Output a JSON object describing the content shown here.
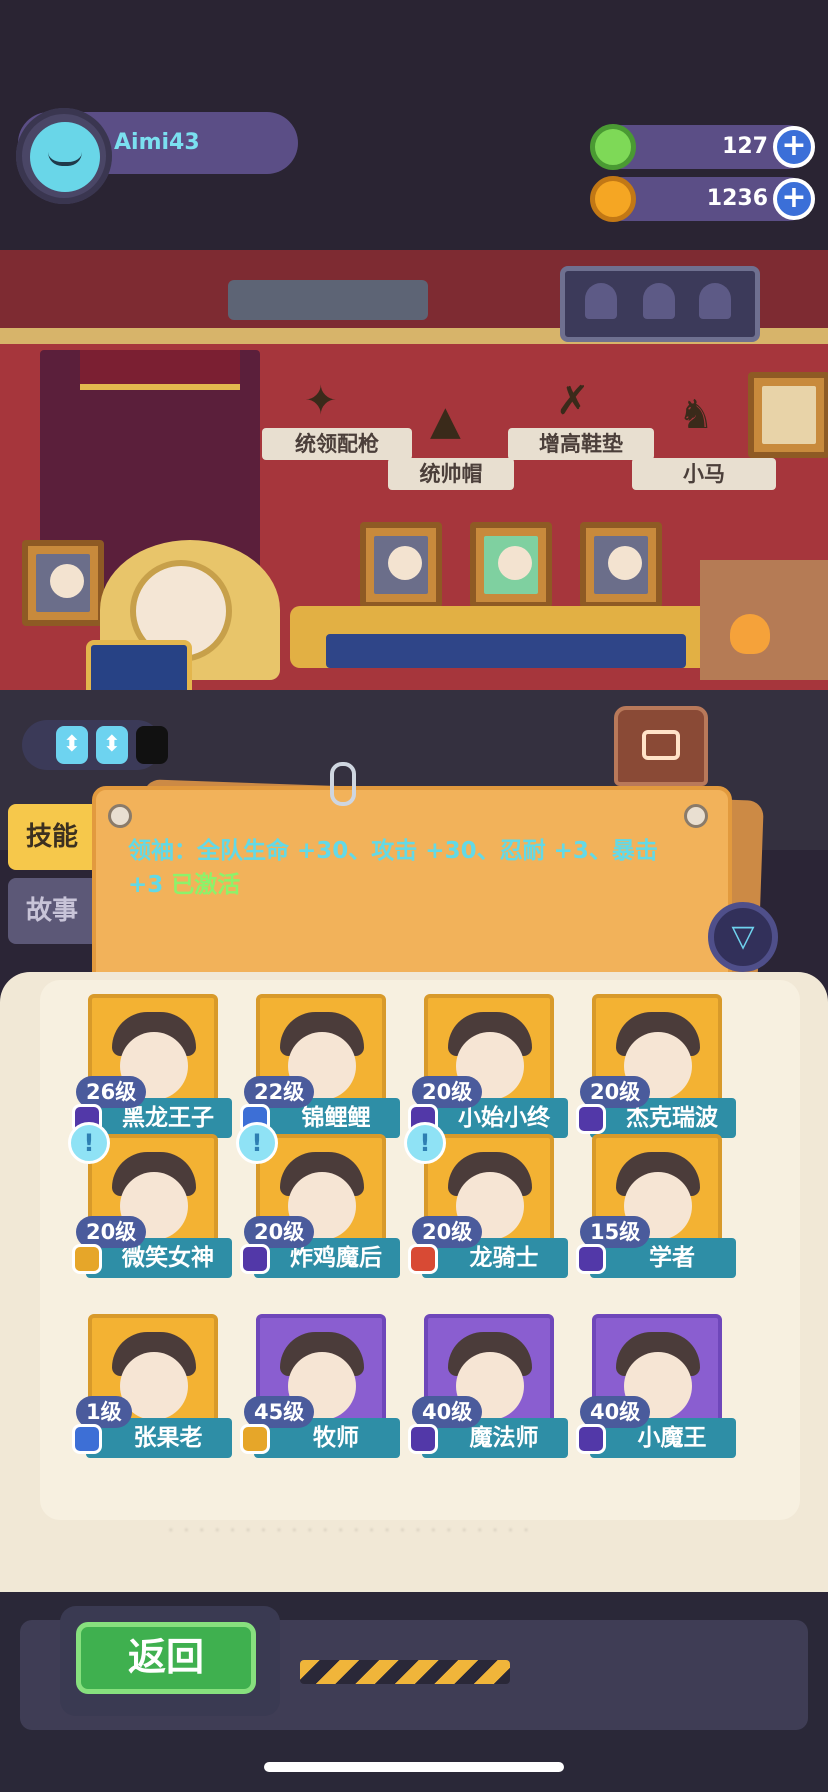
{
  "player": {
    "name": "Aimi43"
  },
  "currencies": [
    {
      "icon": "donut-icon",
      "value": "127",
      "color": "#7ed957"
    },
    {
      "icon": "planet-coin-icon",
      "value": "1236",
      "color": "#f5a623"
    }
  ],
  "equipment": {
    "items": [
      {
        "label": "统领配枪",
        "icon": "pistol-icon"
      },
      {
        "label": "统帅帽",
        "icon": "bicorne-hat-icon"
      },
      {
        "label": "增高鞋垫",
        "icon": "insole-icon"
      },
      {
        "label": "小马",
        "icon": "horse-icon"
      }
    ]
  },
  "side_tabs": {
    "skill": "技能",
    "story": "故事"
  },
  "skill": {
    "text": "领袖：全队生命 +30、攻击 +30、忍耐 +3、暴击 +3",
    "status": "已激活"
  },
  "heroes": [
    {
      "level": "26级",
      "name": "黑龙王子",
      "badge": "purple",
      "card": "gold",
      "notice": false
    },
    {
      "level": "22级",
      "name": "锦鲤鲤",
      "badge": "blue",
      "card": "gold",
      "notice": false
    },
    {
      "level": "20级",
      "name": "小始小终",
      "badge": "purple",
      "card": "gold",
      "notice": false
    },
    {
      "level": "20级",
      "name": "杰克瑞波",
      "badge": "purple",
      "card": "gold",
      "notice": false
    },
    {
      "level": "20级",
      "name": "微笑女神",
      "badge": "gold",
      "card": "gold",
      "notice": true
    },
    {
      "level": "20级",
      "name": "炸鸡魔后",
      "badge": "purple",
      "card": "gold",
      "notice": true
    },
    {
      "level": "20级",
      "name": "龙骑士",
      "badge": "red",
      "card": "gold",
      "notice": true
    },
    {
      "level": "15级",
      "name": "学者",
      "badge": "purple",
      "card": "gold",
      "notice": false
    },
    {
      "level": "1级",
      "name": "张果老",
      "badge": "blue",
      "card": "gold",
      "notice": false
    },
    {
      "level": "45级",
      "name": "牧师",
      "badge": "gold",
      "card": "purple",
      "notice": false
    },
    {
      "level": "40级",
      "name": "魔法师",
      "badge": "purple",
      "card": "purple",
      "notice": false
    },
    {
      "level": "40级",
      "name": "小魔王",
      "badge": "purple",
      "card": "purple",
      "notice": false
    }
  ],
  "buttons": {
    "back": "返回",
    "plus": "+"
  },
  "colors": {
    "accent": "#63d9e6",
    "active": "#8df26a",
    "book": "#f1e8d6"
  }
}
